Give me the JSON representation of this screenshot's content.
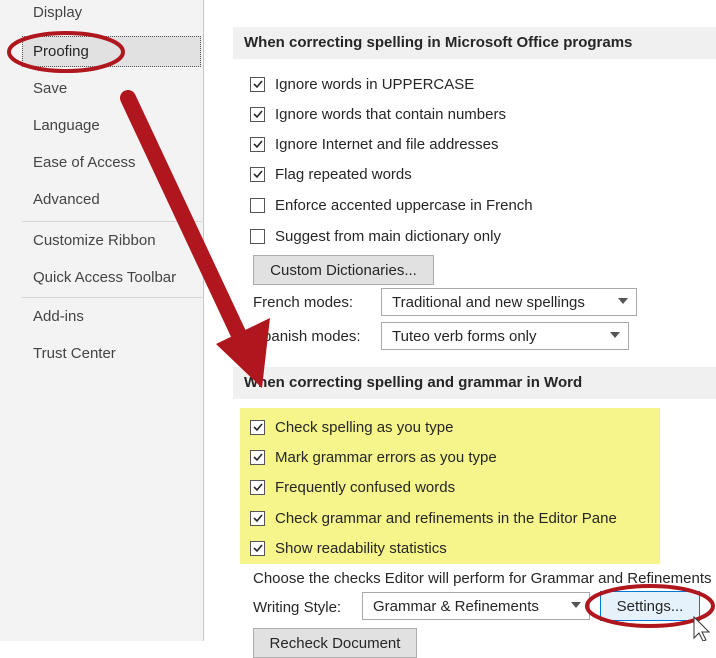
{
  "sidebar": {
    "items": [
      {
        "label": "Display"
      },
      {
        "label": "Proofing"
      },
      {
        "label": "Save"
      },
      {
        "label": "Language"
      },
      {
        "label": "Ease of Access"
      },
      {
        "label": "Advanced"
      },
      {
        "label": "Customize Ribbon"
      },
      {
        "label": "Quick Access Toolbar"
      },
      {
        "label": "Add-ins"
      },
      {
        "label": "Trust Center"
      }
    ]
  },
  "office_section": {
    "title": "When correcting spelling in Microsoft Office programs",
    "options": [
      {
        "label": "Ignore words in UPPERCASE",
        "checked": true
      },
      {
        "label": "Ignore words that contain numbers",
        "checked": true
      },
      {
        "label": "Ignore Internet and file addresses",
        "checked": true
      },
      {
        "label": "Flag repeated words",
        "checked": true
      },
      {
        "label": "Enforce accented uppercase in French",
        "checked": false
      },
      {
        "label": "Suggest from main dictionary only",
        "checked": false
      }
    ],
    "custom_dictionaries_label": "Custom Dictionaries...",
    "french_modes_label": "French modes:",
    "french_modes_value": "Traditional and new spellings",
    "spanish_modes_label": "Spanish modes:",
    "spanish_modes_value": "Tuteo verb forms only"
  },
  "word_section": {
    "title": "When correcting spelling and grammar in Word",
    "options": [
      {
        "label": "Check spelling as you type",
        "checked": true
      },
      {
        "label": "Mark grammar errors as you type",
        "checked": true
      },
      {
        "label": "Frequently confused words",
        "checked": true
      },
      {
        "label": "Check grammar and refinements in the Editor Pane",
        "checked": true
      },
      {
        "label": "Show readability statistics",
        "checked": true
      }
    ],
    "choose_checks_text": "Choose the checks Editor will perform for Grammar and Refinements",
    "writing_style_label": "Writing Style:",
    "writing_style_value": "Grammar & Refinements",
    "settings_label": "Settings...",
    "recheck_label": "Recheck Document"
  },
  "colors": {
    "annotation_red": "#b0161d",
    "highlight_yellow": "#f5f58c"
  }
}
